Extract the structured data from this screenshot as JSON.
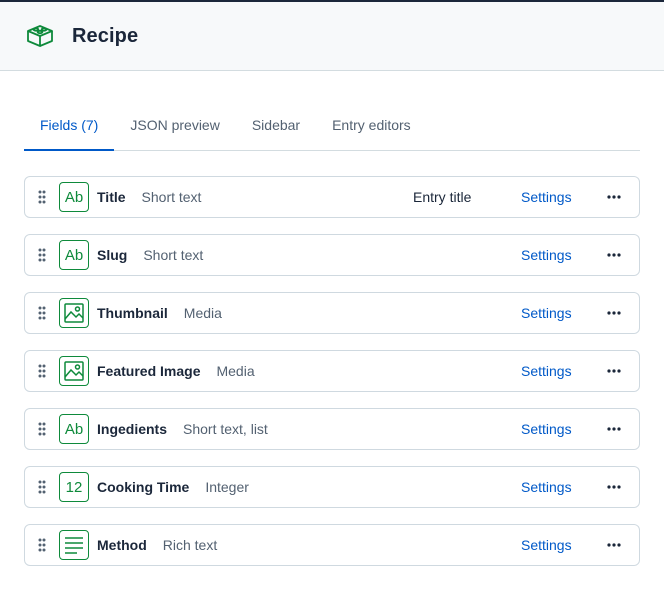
{
  "header": {
    "icon": "content-type-icon",
    "title": "Recipe"
  },
  "tabs": [
    {
      "label": "Fields (7)",
      "active": true
    },
    {
      "label": "JSON preview",
      "active": false
    },
    {
      "label": "Sidebar",
      "active": false
    },
    {
      "label": "Entry editors",
      "active": false
    }
  ],
  "fields": [
    {
      "icon": "short-text-icon",
      "icon_text": "Ab",
      "name": "Title",
      "type": "Short text",
      "entry_title": "Entry title",
      "settings": "Settings"
    },
    {
      "icon": "short-text-icon",
      "icon_text": "Ab",
      "name": "Slug",
      "type": "Short text",
      "entry_title": "",
      "settings": "Settings"
    },
    {
      "icon": "media-icon",
      "icon_text": "",
      "name": "Thumbnail",
      "type": "Media",
      "entry_title": "",
      "settings": "Settings"
    },
    {
      "icon": "media-icon",
      "icon_text": "",
      "name": "Featured Image",
      "type": "Media",
      "entry_title": "",
      "settings": "Settings"
    },
    {
      "icon": "short-text-icon",
      "icon_text": "Ab",
      "name": "Ingedients",
      "type": "Short text, list",
      "entry_title": "",
      "settings": "Settings"
    },
    {
      "icon": "integer-icon",
      "icon_text": "12",
      "name": "Cooking Time",
      "type": "Integer",
      "entry_title": "",
      "settings": "Settings"
    },
    {
      "icon": "rich-text-icon",
      "icon_text": "",
      "name": "Method",
      "type": "Rich text",
      "entry_title": "",
      "settings": "Settings"
    }
  ],
  "colors": {
    "accent": "#0059c8",
    "field_icon": "#0e8a3b",
    "text": "#1b273a",
    "muted": "#536171",
    "border": "#cfd9e0"
  }
}
